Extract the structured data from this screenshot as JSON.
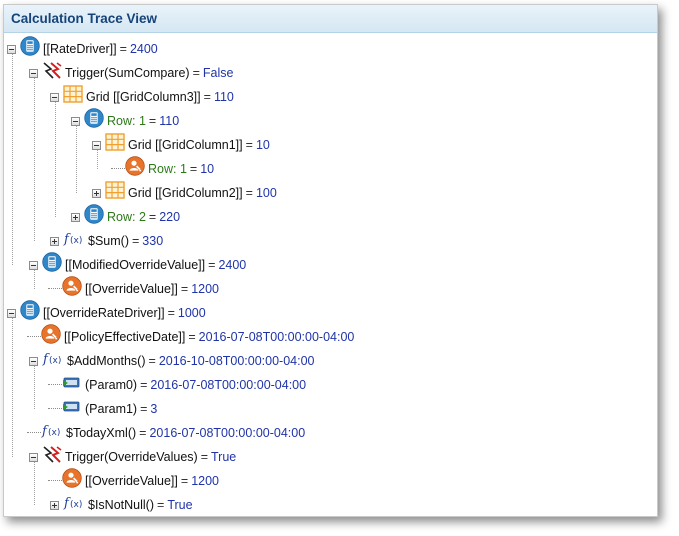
{
  "panel": {
    "title": "Calculation Trace View"
  },
  "rows": [
    {
      "label": "[[RateDriver]]",
      "value": "2400",
      "icon": "calculator-icon"
    },
    {
      "label": "Trigger(SumCompare)",
      "value": "False",
      "icon": "trigger-icon"
    },
    {
      "label": "Grid [[GridColumn3]]",
      "value": "110",
      "icon": "grid-icon"
    },
    {
      "label": "Row: 1",
      "value": "110",
      "icon": "calculator-icon"
    },
    {
      "label": "Grid [[GridColumn1]]",
      "value": "10",
      "icon": "grid-icon"
    },
    {
      "label": "Row: 1",
      "value": "10",
      "icon": "override-user-icon"
    },
    {
      "label": "Grid [[GridColumn2]]",
      "value": "100",
      "icon": "grid-icon"
    },
    {
      "label": "Row: 2",
      "value": "220",
      "icon": "calculator-icon"
    },
    {
      "label": "$Sum()",
      "value": "330",
      "icon": "function-icon"
    },
    {
      "label": "[[ModifiedOverrideValue]]",
      "value": "2400",
      "icon": "calculator-icon"
    },
    {
      "label": "[[OverrideValue]]",
      "value": "1200",
      "icon": "override-user-icon"
    },
    {
      "label": "[[OverrideRateDriver]]",
      "value": "1000",
      "icon": "calculator-icon"
    },
    {
      "label": "[[PolicyEffectiveDate]]",
      "value": "2016-07-08T00:00:00-04:00",
      "icon": "override-user-icon"
    },
    {
      "label": "$AddMonths()",
      "value": "2016-10-08T00:00:00-04:00",
      "icon": "function-icon"
    },
    {
      "label": "(Param0)",
      "value": "2016-07-08T00:00:00-04:00",
      "icon": "parameter-icon"
    },
    {
      "label": "(Param1)",
      "value": "3",
      "icon": "parameter-icon"
    },
    {
      "label": "$TodayXml()",
      "value": "2016-07-08T00:00:00-04:00",
      "icon": "function-icon"
    },
    {
      "label": "Trigger(OverrideValues)",
      "value": "True",
      "icon": "trigger-icon"
    },
    {
      "label": "[[OverrideValue]]",
      "value": "1200",
      "icon": "override-user-icon"
    },
    {
      "label": "$IsNotNull()",
      "value": "True",
      "icon": "function-icon"
    }
  ],
  "equals_sign": "=",
  "colors": {
    "header_text": "#16447a",
    "value_text": "#2034a8",
    "row_label_green": "#2b7a17",
    "calculator_blue": "#2f86c9",
    "override_orange": "#e8732a",
    "grid_orange": "#f0a030",
    "trigger_red": "#d42020"
  }
}
